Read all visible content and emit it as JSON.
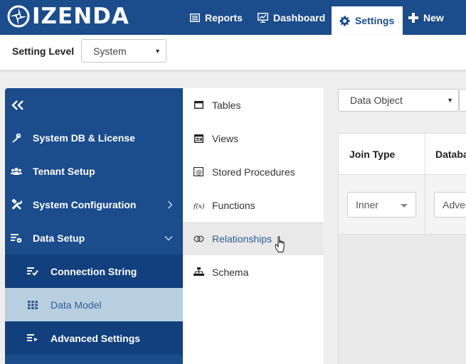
{
  "brand": {
    "name": "IZENDA"
  },
  "nav": {
    "reports": "Reports",
    "dashboard": "Dashboard",
    "settings": "Settings",
    "new": "New"
  },
  "level": {
    "label": "Setting Level",
    "value": "System"
  },
  "sidebar": {
    "items": [
      {
        "label": "System DB & License",
        "icon": "key-icon"
      },
      {
        "label": "Tenant Setup",
        "icon": "users-icon"
      },
      {
        "label": "System Configuration",
        "icon": "tools-icon"
      },
      {
        "label": "Data Setup",
        "icon": "data-settings-icon"
      }
    ],
    "subitems": [
      {
        "label": "Connection String",
        "icon": "list-check-icon"
      },
      {
        "label": "Data Model",
        "icon": "grid-icon"
      },
      {
        "label": "Advanced Settings",
        "icon": "list-arrow-icon"
      }
    ]
  },
  "menu": {
    "items": [
      {
        "label": "Tables",
        "icon": "table-icon"
      },
      {
        "label": "Views",
        "icon": "view-icon"
      },
      {
        "label": "Stored Procedures",
        "icon": "at-icon"
      },
      {
        "label": "Functions",
        "icon": "function-icon"
      },
      {
        "label": "Relationships",
        "icon": "link-icon"
      },
      {
        "label": "Schema",
        "icon": "schema-icon"
      }
    ]
  },
  "content": {
    "object_select": "Data Object",
    "columns": [
      "Join Type",
      "Databa"
    ],
    "row": {
      "join_type": "Inner",
      "database": "Adver"
    }
  },
  "colors": {
    "navbar": "#1b4c8c",
    "sidebar": "#1b4c8c",
    "subitem": "#12407e",
    "active_subitem": "#b9cfe0",
    "link": "#2d5e95"
  }
}
